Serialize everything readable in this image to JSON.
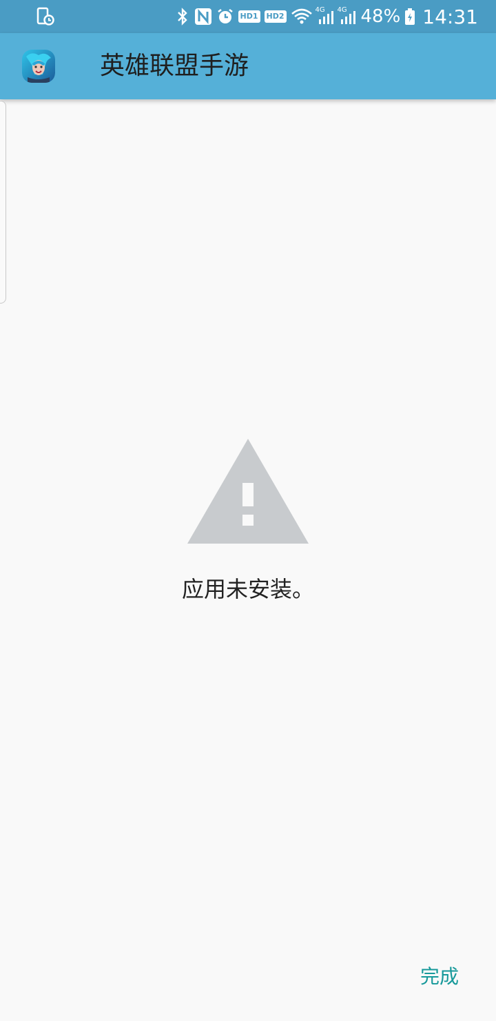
{
  "status_bar": {
    "left_icon": "cast-screen-icon",
    "icons": [
      "bluetooth-icon",
      "nfc-icon",
      "alarm-icon",
      "hd1-icon",
      "hd2-icon",
      "wifi-icon",
      "signal-4g-icon",
      "signal-4g-icon"
    ],
    "hd1": "HD1",
    "hd2": "HD2",
    "net1": "4G",
    "net2": "4G",
    "battery": "48%",
    "time": "14:31"
  },
  "app_bar": {
    "icon": "game-app-icon",
    "title": "英雄联盟手游"
  },
  "main": {
    "icon": "warning-icon",
    "message": "应用未安装。"
  },
  "footer": {
    "done_label": "完成",
    "accent_color": "#16999a"
  },
  "colors": {
    "status_bar_bg": "#4a9cc4",
    "app_bar_bg": "#55b0d8",
    "warning_fill": "#c8cbce"
  }
}
